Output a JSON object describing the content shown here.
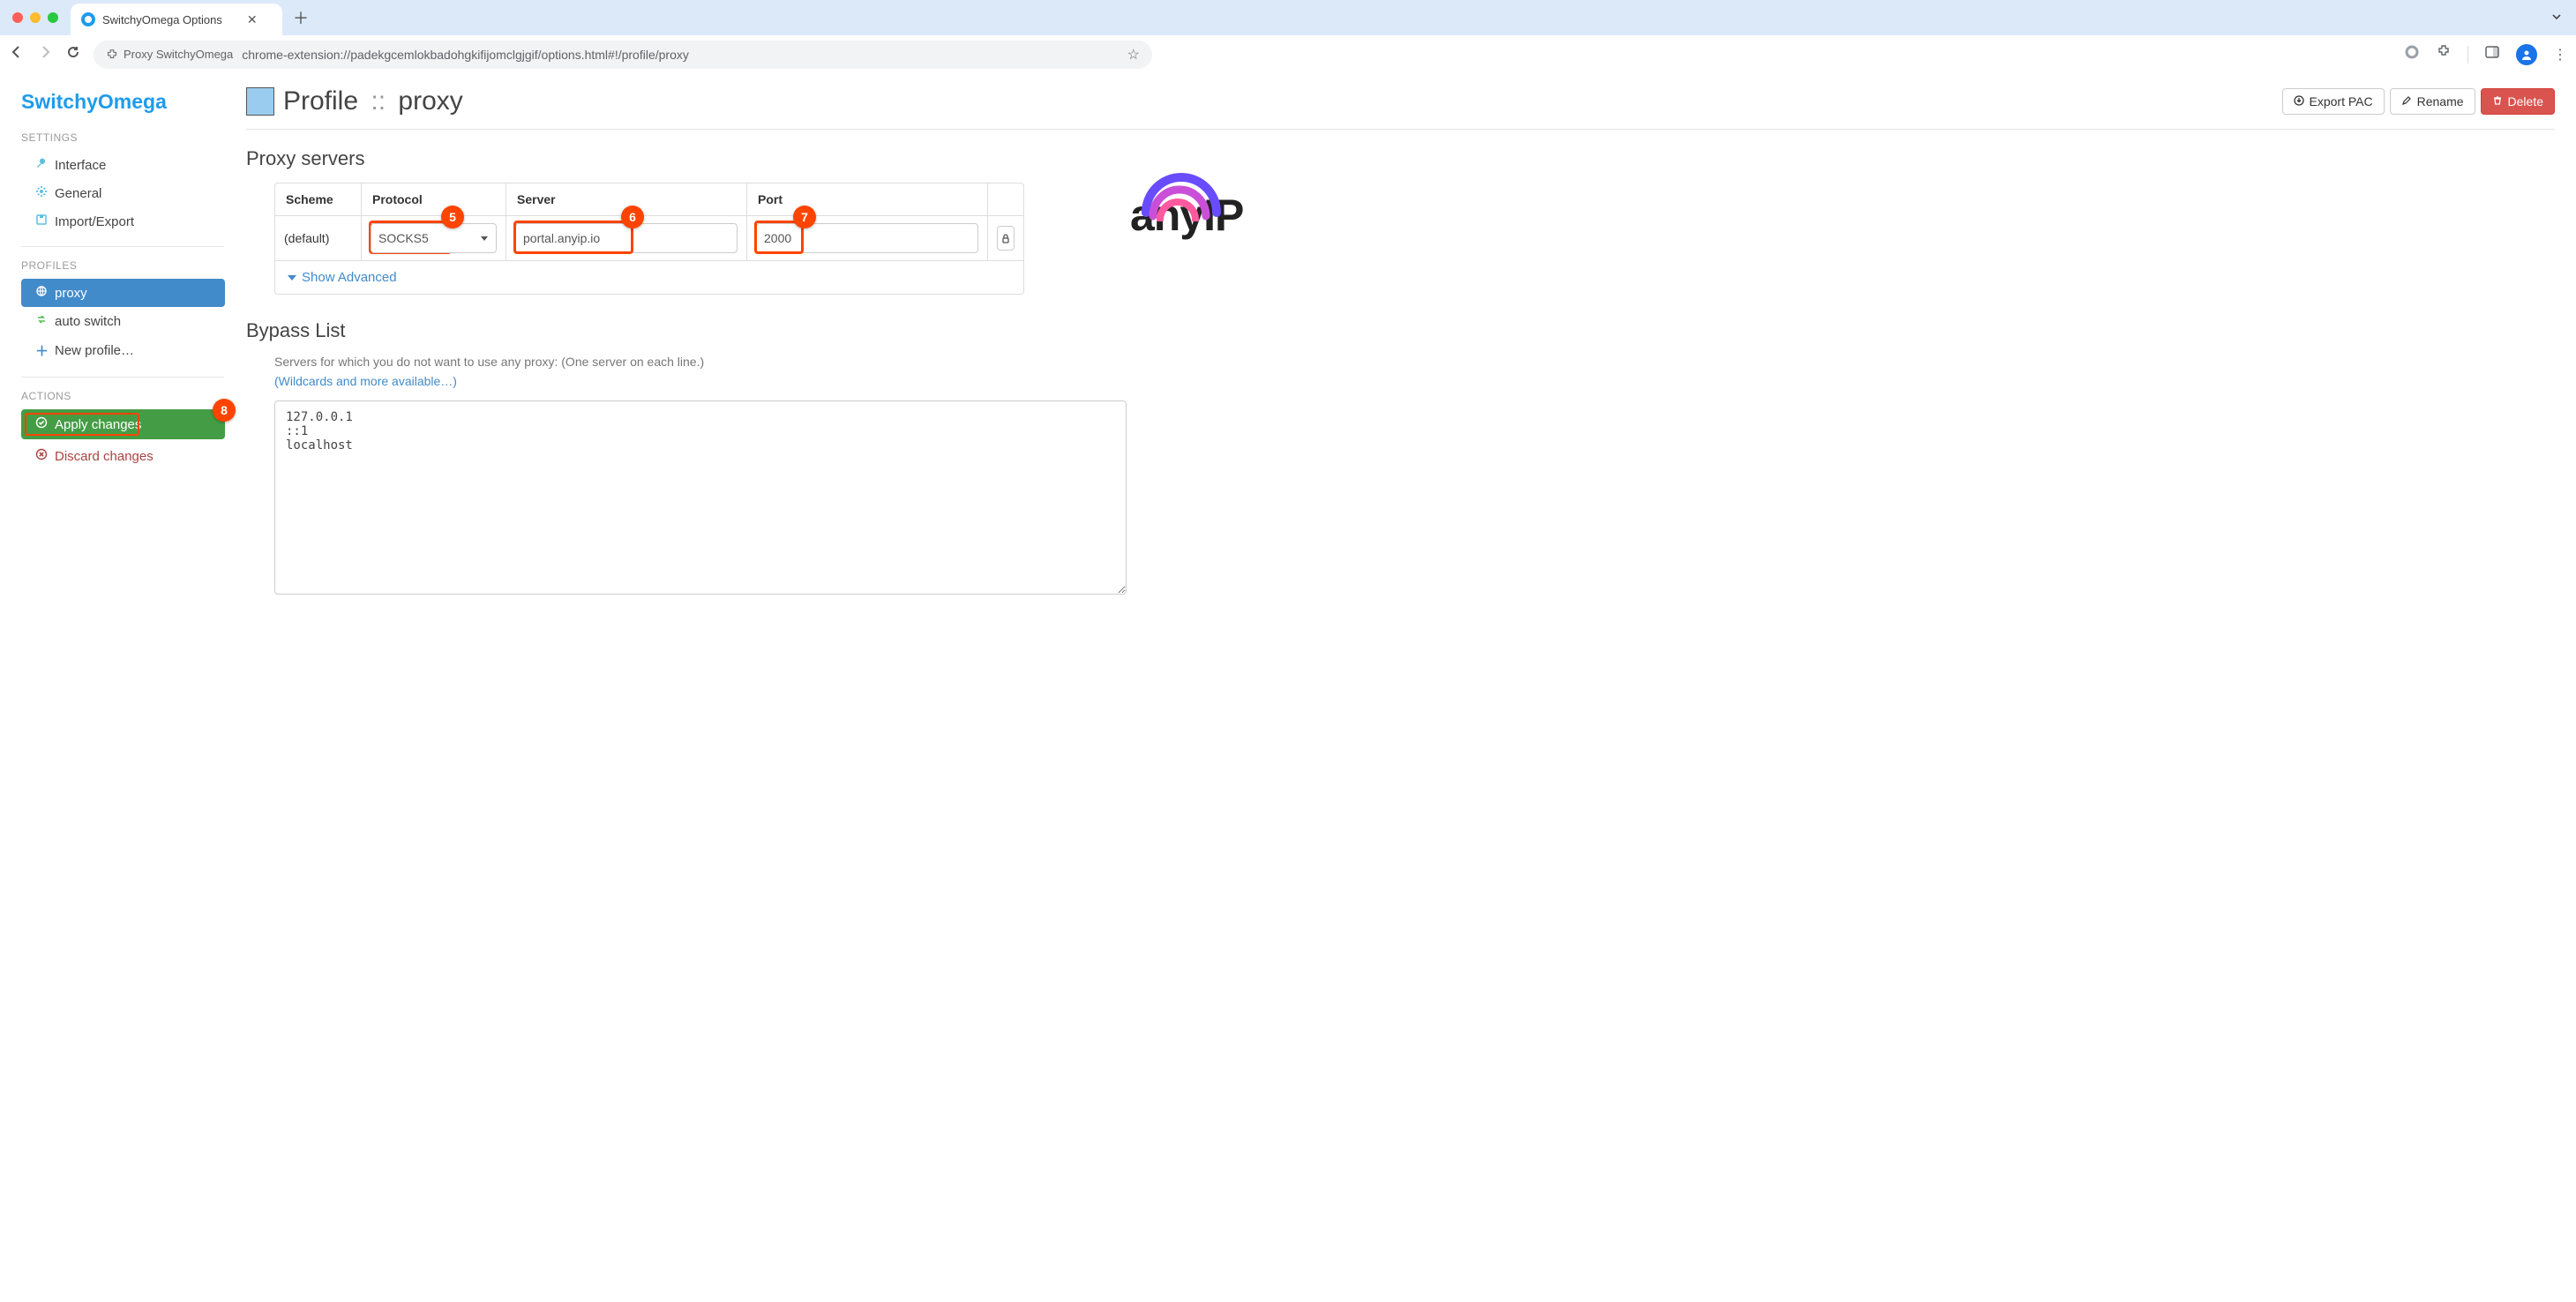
{
  "browser": {
    "tab_title": "SwitchyOmega Options",
    "ext_name": "Proxy SwitchyOmega",
    "url": "chrome-extension://padekgcemlokbadohgkifijomclgjgif/options.html#!/profile/proxy"
  },
  "brand": "SwitchyOmega",
  "sidebar": {
    "settings_label": "SETTINGS",
    "profiles_label": "PROFILES",
    "actions_label": "ACTIONS",
    "settings": {
      "interface": "Interface",
      "general": "General",
      "import_export": "Import/Export"
    },
    "profiles": {
      "proxy": "proxy",
      "autoswitch": "auto switch",
      "new_profile": "New profile…"
    },
    "actions": {
      "apply": "Apply changes",
      "discard": "Discard changes"
    }
  },
  "header": {
    "prefix": "Profile",
    "sep": "::",
    "name": "proxy",
    "export_pac": "Export PAC",
    "rename": "Rename",
    "delete": "Delete"
  },
  "proxy": {
    "title": "Proxy servers",
    "cols": {
      "scheme": "Scheme",
      "protocol": "Protocol",
      "server": "Server",
      "port": "Port"
    },
    "row": {
      "scheme": "(default)",
      "protocol": "SOCKS5",
      "server": "portal.anyip.io",
      "port": "2000"
    },
    "show_advanced": "Show Advanced"
  },
  "bypass": {
    "title": "Bypass List",
    "desc": "Servers for which you do not want to use any proxy: (One server on each line.)",
    "link": "(Wildcards and more available…)",
    "value": "127.0.0.1\n::1\nlocalhost"
  },
  "badges": {
    "b5": "5",
    "b6": "6",
    "b7": "7",
    "b8": "8"
  },
  "logo": "anyIP"
}
